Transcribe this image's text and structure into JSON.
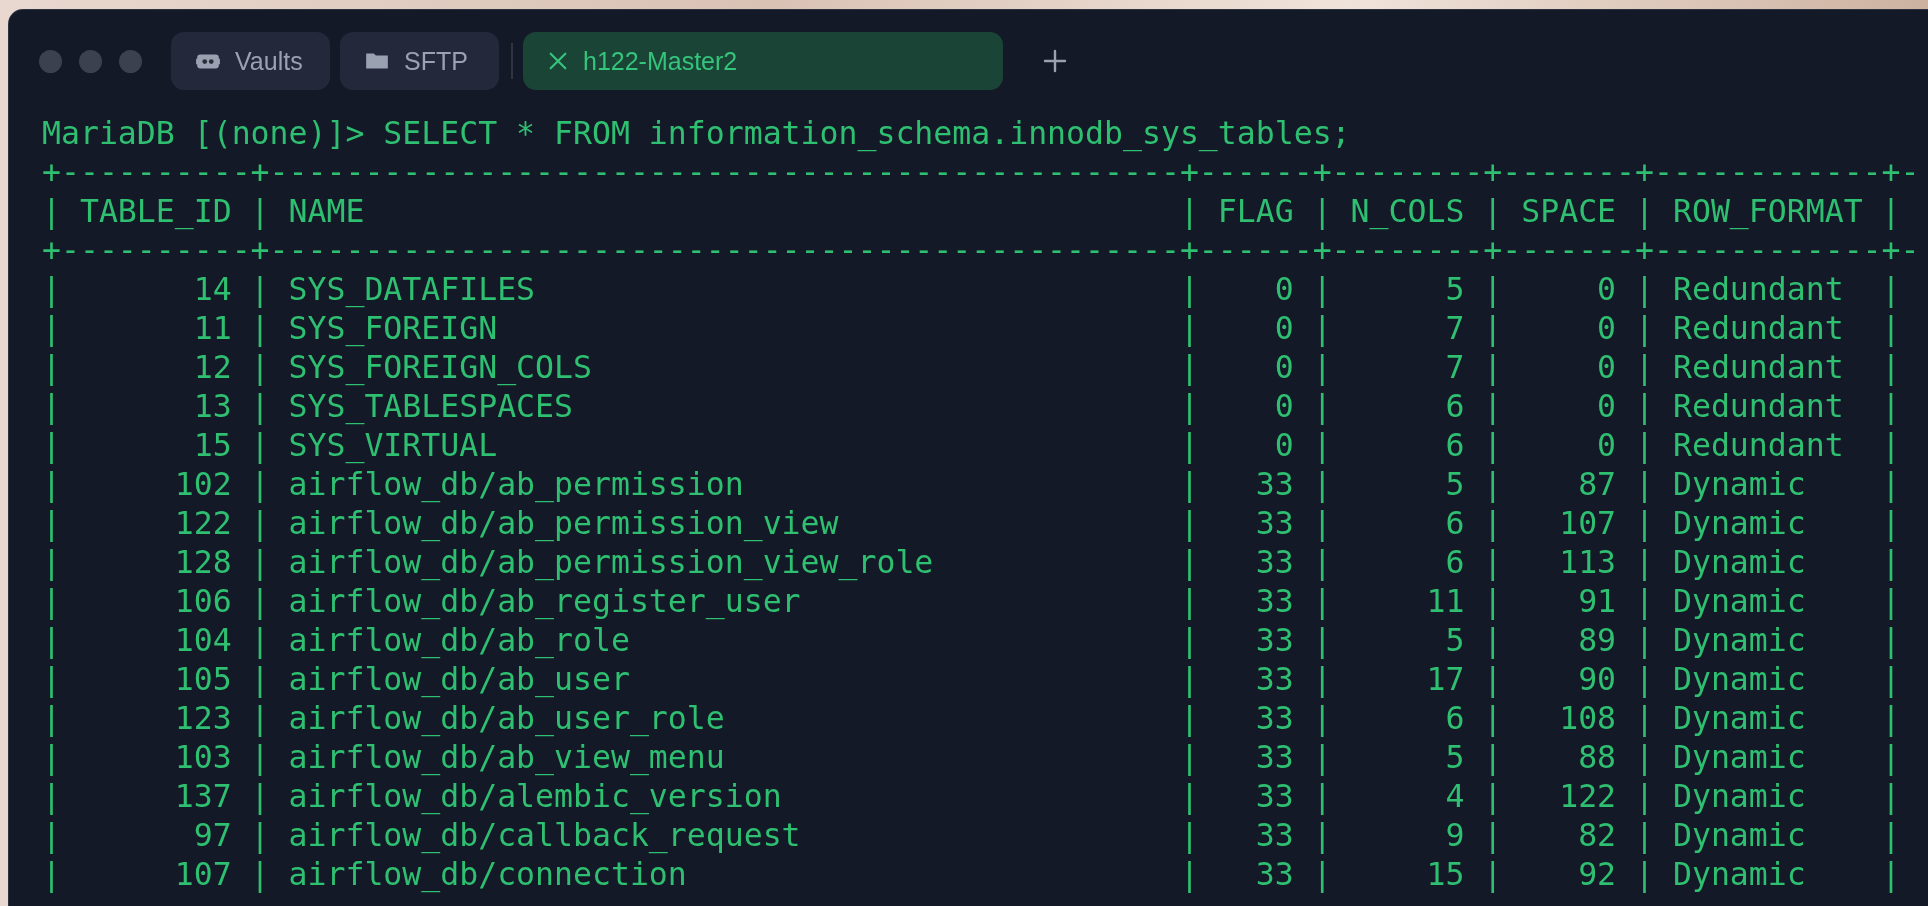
{
  "tabs": [
    {
      "label": "Vaults",
      "kind": "vault",
      "selected": false
    },
    {
      "label": "SFTP",
      "kind": "folder",
      "selected": false
    },
    {
      "label": "h122-Master2",
      "kind": "session",
      "selected": true
    }
  ],
  "terminal": {
    "prompt": "MariaDB [(none)]> SELECT * FROM information_schema.innodb_sys_tables;",
    "border": "+----------+------------------------------------------------+------+--------+-------+------------+-",
    "separator": "|",
    "columns": [
      {
        "label": "TABLE_ID"
      },
      {
        "label": "NAME"
      },
      {
        "label": "FLAG"
      },
      {
        "label": "N_COLS"
      },
      {
        "label": "SPACE"
      },
      {
        "label": "ROW_FORMAT"
      }
    ],
    "rows": [
      [
        "14",
        "SYS_DATAFILES",
        "0",
        "5",
        "0",
        "Redundant"
      ],
      [
        "11",
        "SYS_FOREIGN",
        "0",
        "7",
        "0",
        "Redundant"
      ],
      [
        "12",
        "SYS_FOREIGN_COLS",
        "0",
        "7",
        "0",
        "Redundant"
      ],
      [
        "13",
        "SYS_TABLESPACES",
        "0",
        "6",
        "0",
        "Redundant"
      ],
      [
        "15",
        "SYS_VIRTUAL",
        "0",
        "6",
        "0",
        "Redundant"
      ],
      [
        "102",
        "airflow_db/ab_permission",
        "33",
        "5",
        "87",
        "Dynamic"
      ],
      [
        "122",
        "airflow_db/ab_permission_view",
        "33",
        "6",
        "107",
        "Dynamic"
      ],
      [
        "128",
        "airflow_db/ab_permission_view_role",
        "33",
        "6",
        "113",
        "Dynamic"
      ],
      [
        "106",
        "airflow_db/ab_register_user",
        "33",
        "11",
        "91",
        "Dynamic"
      ],
      [
        "104",
        "airflow_db/ab_role",
        "33",
        "5",
        "89",
        "Dynamic"
      ],
      [
        "105",
        "airflow_db/ab_user",
        "33",
        "17",
        "90",
        "Dynamic"
      ],
      [
        "123",
        "airflow_db/ab_user_role",
        "33",
        "6",
        "108",
        "Dynamic"
      ],
      [
        "103",
        "airflow_db/ab_view_menu",
        "33",
        "5",
        "88",
        "Dynamic"
      ],
      [
        "137",
        "airflow_db/alembic_version",
        "33",
        "4",
        "122",
        "Dynamic"
      ],
      [
        "97",
        "airflow_db/callback_request",
        "33",
        "9",
        "82",
        "Dynamic"
      ],
      [
        "107",
        "airflow_db/connection",
        "33",
        "15",
        "92",
        "Dynamic"
      ]
    ]
  }
}
